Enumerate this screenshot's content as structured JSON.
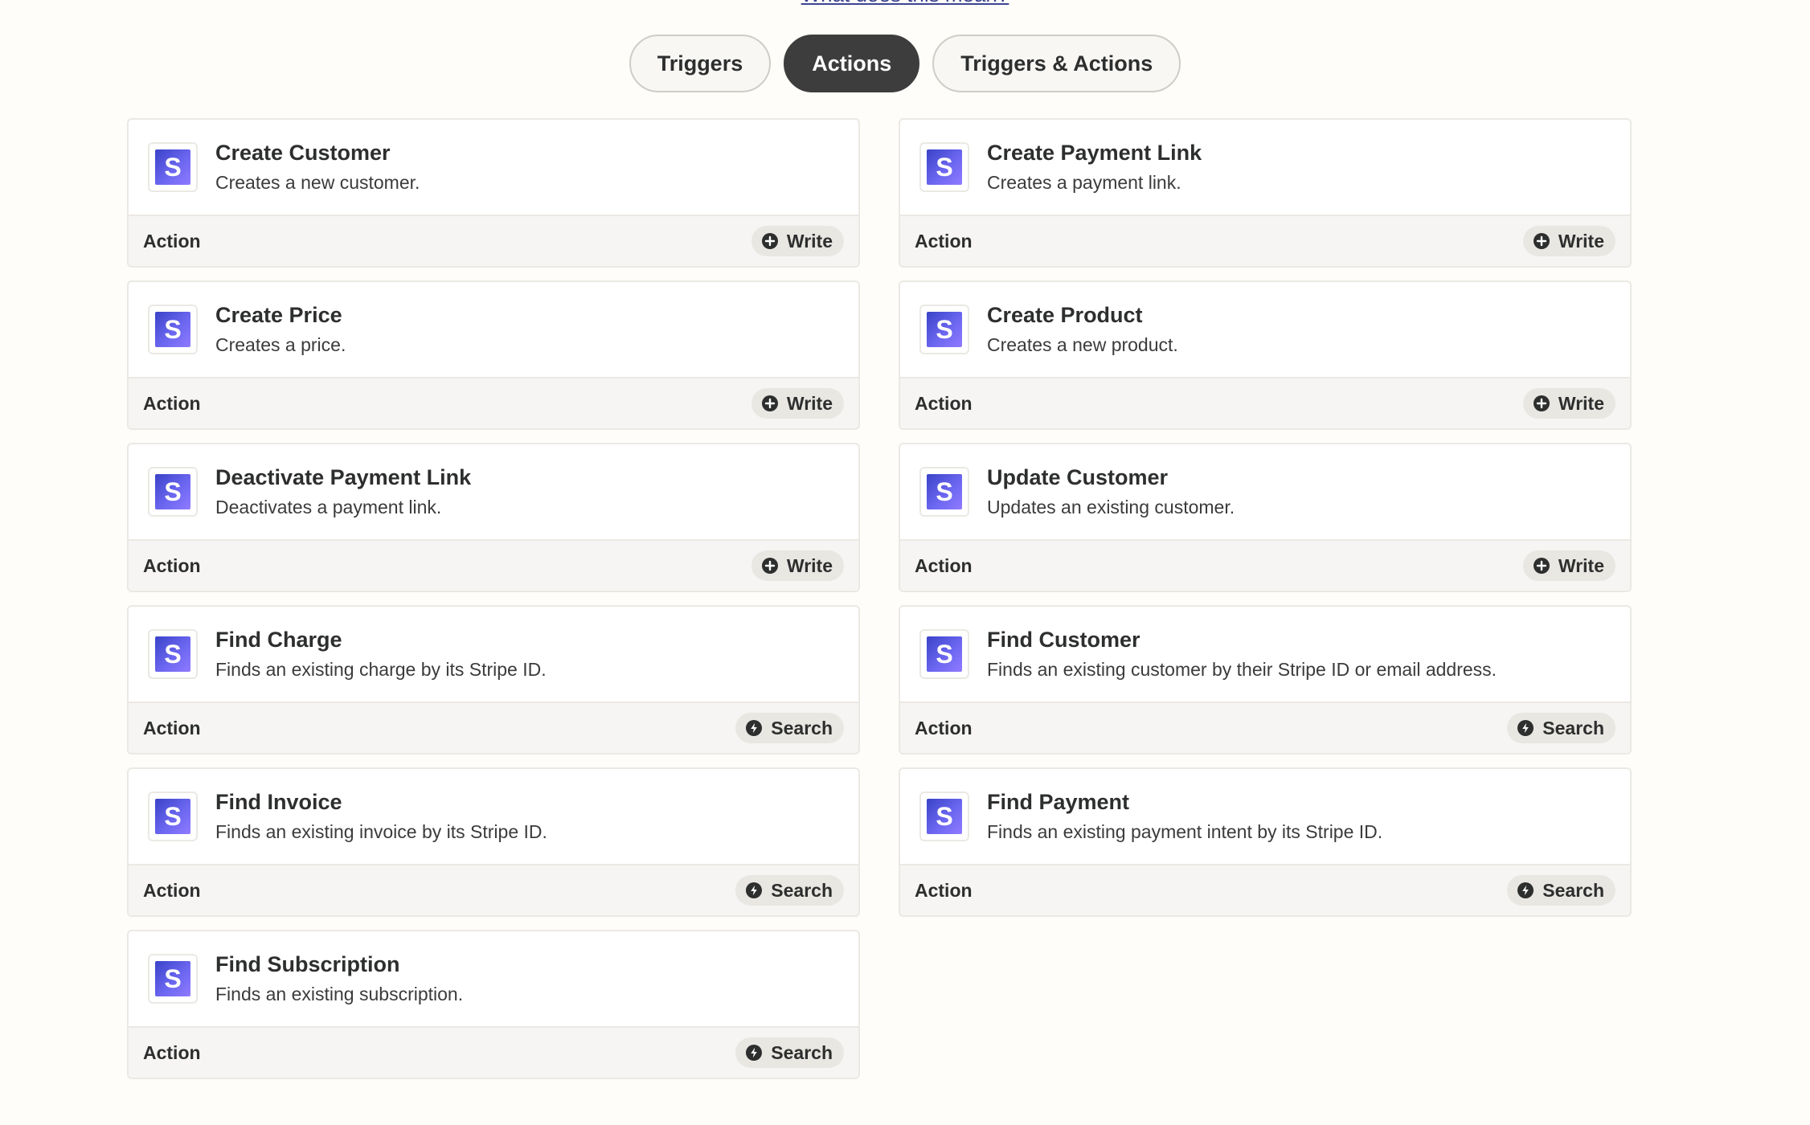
{
  "header": {
    "link_text": "What does this mean?"
  },
  "tabs": [
    {
      "label": "Triggers",
      "active": false
    },
    {
      "label": "Actions",
      "active": true
    },
    {
      "label": "Triggers & Actions",
      "active": false
    }
  ],
  "cards": [
    {
      "title": "Create Customer",
      "description": "Creates a new customer.",
      "kind": "Action",
      "badge": "Write",
      "badge_icon": "plus-circle-icon",
      "app_icon": "stripe-logo-icon",
      "app_letter": "S"
    },
    {
      "title": "Create Payment Link",
      "description": "Creates a payment link.",
      "kind": "Action",
      "badge": "Write",
      "badge_icon": "plus-circle-icon",
      "app_icon": "stripe-logo-icon",
      "app_letter": "S"
    },
    {
      "title": "Create Price",
      "description": "Creates a price.",
      "kind": "Action",
      "badge": "Write",
      "badge_icon": "plus-circle-icon",
      "app_icon": "stripe-logo-icon",
      "app_letter": "S"
    },
    {
      "title": "Create Product",
      "description": "Creates a new product.",
      "kind": "Action",
      "badge": "Write",
      "badge_icon": "plus-circle-icon",
      "app_icon": "stripe-logo-icon",
      "app_letter": "S"
    },
    {
      "title": "Deactivate Payment Link",
      "description": "Deactivates a payment link.",
      "kind": "Action",
      "badge": "Write",
      "badge_icon": "plus-circle-icon",
      "app_icon": "stripe-logo-icon",
      "app_letter": "S"
    },
    {
      "title": "Update Customer",
      "description": "Updates an existing customer.",
      "kind": "Action",
      "badge": "Write",
      "badge_icon": "plus-circle-icon",
      "app_icon": "stripe-logo-icon",
      "app_letter": "S"
    },
    {
      "title": "Find Charge",
      "description": "Finds an existing charge by its Stripe ID.",
      "kind": "Action",
      "badge": "Search",
      "badge_icon": "bolt-circle-icon",
      "app_icon": "stripe-logo-icon",
      "app_letter": "S"
    },
    {
      "title": "Find Customer",
      "description": "Finds an existing customer by their Stripe ID or email address.",
      "kind": "Action",
      "badge": "Search",
      "badge_icon": "bolt-circle-icon",
      "app_icon": "stripe-logo-icon",
      "app_letter": "S"
    },
    {
      "title": "Find Invoice",
      "description": "Finds an existing invoice by its Stripe ID.",
      "kind": "Action",
      "badge": "Search",
      "badge_icon": "bolt-circle-icon",
      "app_icon": "stripe-logo-icon",
      "app_letter": "S"
    },
    {
      "title": "Find Payment",
      "description": "Finds an existing payment intent by its Stripe ID.",
      "kind": "Action",
      "badge": "Search",
      "badge_icon": "bolt-circle-icon",
      "app_icon": "stripe-logo-icon",
      "app_letter": "S"
    },
    {
      "title": "Find Subscription",
      "description": "Finds an existing subscription.",
      "kind": "Action",
      "badge": "Search",
      "badge_icon": "bolt-circle-icon",
      "app_icon": "stripe-logo-icon",
      "app_letter": "S"
    }
  ],
  "colors": {
    "background": "#fffdf9",
    "active_tab": "#3d3d3d",
    "stripe_logo_start": "#3a43c8",
    "stripe_logo_end": "#8f7bff",
    "card_footer": "#f6f5f3"
  }
}
